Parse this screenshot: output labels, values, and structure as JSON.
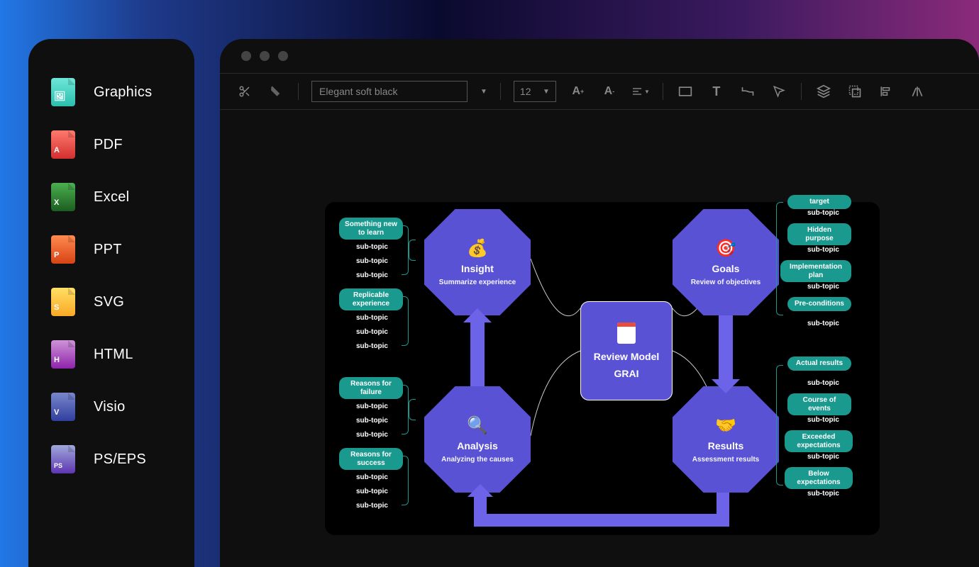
{
  "sidebar": {
    "items": [
      {
        "label": "Graphics",
        "color1": "#3dd6c4",
        "color2": "#2bbfae",
        "glyph": "🖼"
      },
      {
        "label": "PDF",
        "color1": "#f44336",
        "color2": "#d32f2f",
        "glyph": "A"
      },
      {
        "label": "Excel",
        "color1": "#2e7d32",
        "color2": "#1b5e20",
        "glyph": "X"
      },
      {
        "label": "PPT",
        "color1": "#e64a19",
        "color2": "#d84315",
        "glyph": "P"
      },
      {
        "label": "SVG",
        "color1": "#fbc02d",
        "color2": "#f9a825",
        "glyph": "S"
      },
      {
        "label": "HTML",
        "color1": "#ab47bc",
        "color2": "#8e24aa",
        "glyph": "H"
      },
      {
        "label": "Visio",
        "color1": "#3f51b5",
        "color2": "#303f9f",
        "glyph": "V"
      },
      {
        "label": "PS/EPS",
        "color1": "#7e57c2",
        "color2": "#5e35b1",
        "glyph": "PS"
      }
    ]
  },
  "toolbar": {
    "theme_name": "Elegant soft black",
    "font_size": "12"
  },
  "canvas": {
    "center": {
      "title": "Review Model",
      "subtitle": "GRAI"
    },
    "nodes": {
      "insight": {
        "title": "Insight",
        "subtitle": "Summarize experience",
        "icon": "💰"
      },
      "goals": {
        "title": "Goals",
        "subtitle": "Review of objectives",
        "icon": "🎯"
      },
      "analysis": {
        "title": "Analysis",
        "subtitle": "Analyzing the causes",
        "icon": "🔍"
      },
      "results": {
        "title": "Results",
        "subtitle": "Assessment results",
        "icon": "🤝"
      }
    },
    "left_groups": [
      {
        "label": "Something new to learn",
        "subs": [
          "sub-topic",
          "sub-topic",
          "sub-topic"
        ]
      },
      {
        "label": "Replicable experience",
        "subs": [
          "sub-topic",
          "sub-topic",
          "sub-topic"
        ]
      },
      {
        "label": "Reasons for failure",
        "subs": [
          "sub-topic",
          "sub-topic",
          "sub-topic"
        ]
      },
      {
        "label": "Reasons for success",
        "subs": [
          "sub-topic",
          "sub-topic",
          "sub-topic"
        ]
      }
    ],
    "right_groups": [
      {
        "label": "target",
        "subs": [
          "sub-topic"
        ]
      },
      {
        "label": "Hidden purpose",
        "subs": [
          "sub-topic"
        ]
      },
      {
        "label": "Implementation plan",
        "subs": [
          "sub-topic"
        ]
      },
      {
        "label": "Pre-conditions",
        "subs": [
          "sub-topic"
        ]
      },
      {
        "label": "Actual results",
        "subs": [
          "sub-topic"
        ]
      },
      {
        "label": "Course of events",
        "subs": [
          "sub-topic"
        ]
      },
      {
        "label": "Exceeded expectations",
        "subs": [
          "sub-topic"
        ]
      },
      {
        "label": "Below expectations",
        "subs": [
          "sub-topic"
        ]
      }
    ]
  }
}
